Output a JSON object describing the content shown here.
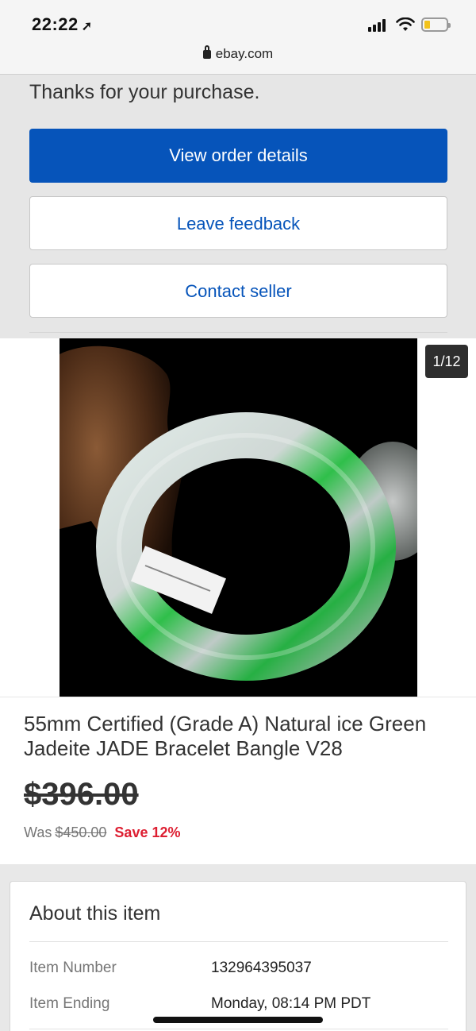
{
  "status_bar": {
    "time": "22:22",
    "location_glyph": "➚"
  },
  "browser": {
    "url": "ebay.com"
  },
  "purchase": {
    "thanks_text": "Thanks for your purchase.",
    "view_order_label": "View order details",
    "leave_feedback_label": "Leave feedback",
    "contact_seller_label": "Contact seller"
  },
  "gallery": {
    "counter": "1/12",
    "image_alt": "jade bangle photo"
  },
  "item": {
    "title": "55mm Certified (Grade A) Natural ice Green Jadeite JADE Bracelet Bangle V28",
    "price": "$396.00",
    "was_label": "Was",
    "was_price": "$450.00",
    "save_label": "Save 12%"
  },
  "about": {
    "title": "About this item",
    "rows": [
      {
        "label": "Item Number",
        "value": "132964395037"
      },
      {
        "label": "Item Ending",
        "value": "Monday, 08:14 PM PDT"
      }
    ]
  },
  "colors": {
    "primary_blue": "#0654ba",
    "save_red": "#dd1e31",
    "battery_yellow": "#f2c21a"
  }
}
